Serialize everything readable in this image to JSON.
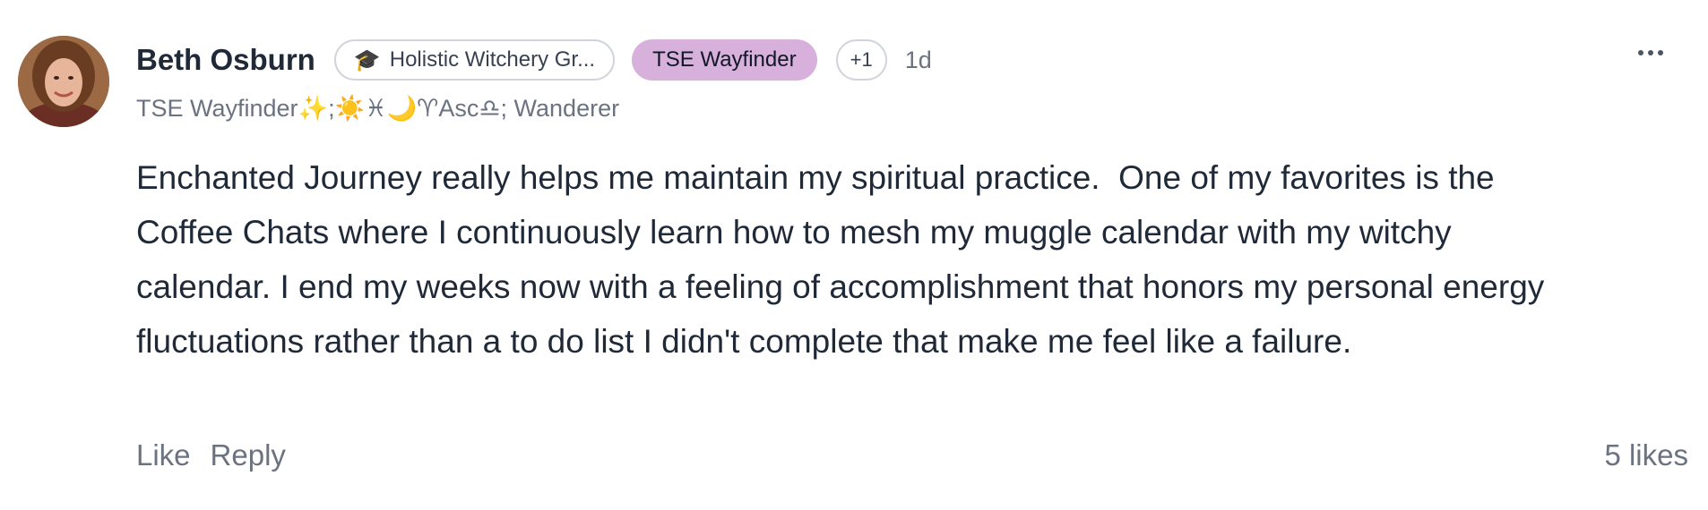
{
  "comment": {
    "author": "Beth Osburn",
    "group_badge": {
      "icon": "graduation-cap-icon",
      "label": "Holistic Witchery Gr..."
    },
    "role_badge": "TSE Wayfinder",
    "more_badges": "+1",
    "timestamp": "1d",
    "subtitle": "TSE Wayfinder✨;☀️♓🌙♈Asc♎; Wanderer",
    "body": "Enchanted Journey really helps me maintain my spiritual practice.  One of my favorites is the Coffee Chats where I continuously learn how to mesh my muggle calendar with my witchy calendar. I end my weeks now with a feeling of accomplishment that honors my personal energy fluctuations rather than a to do list I didn't complete that make me feel like a failure.",
    "like_label": "Like",
    "reply_label": "Reply",
    "likes_count": "5 likes"
  },
  "colors": {
    "role_badge_bg": "#d7b0dc",
    "text_primary": "#1f2937",
    "text_secondary": "#6b7280"
  }
}
